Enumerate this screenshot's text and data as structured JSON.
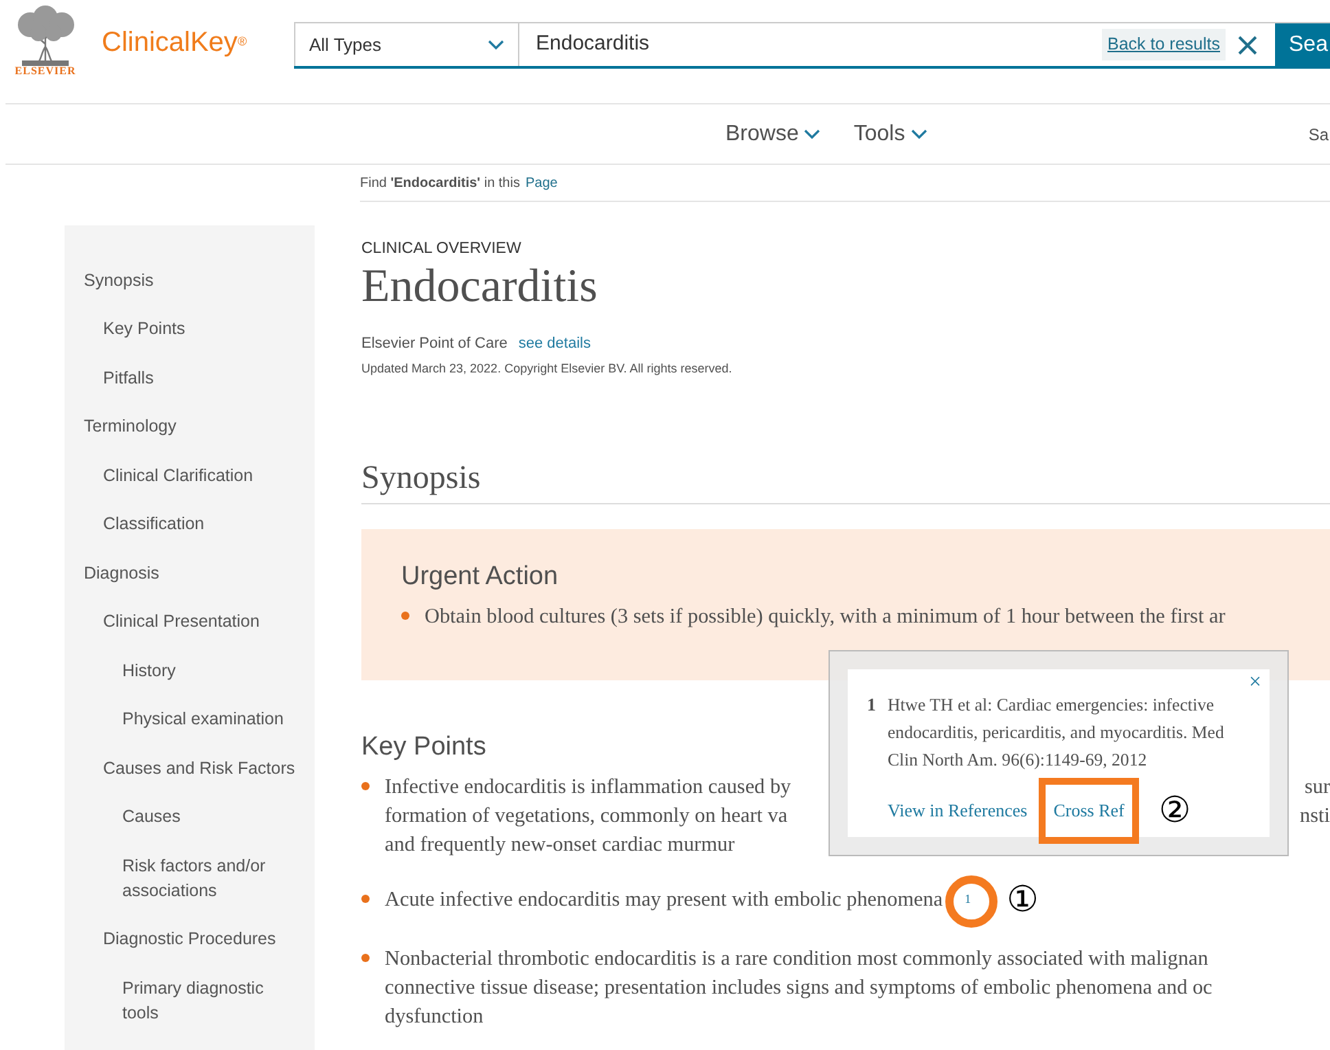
{
  "header": {
    "publisher": "ELSEVIER",
    "brand": "ClinicalKey",
    "brand_mark": "®",
    "search_type": "All Types",
    "search_value": "Endocarditis",
    "back_link": "Back to results",
    "search_button": "Sea"
  },
  "nav": {
    "items": [
      "Browse",
      "Tools"
    ],
    "right_item": "Sa"
  },
  "find_in_page": {
    "text": "Find **'Endocarditis'** in this",
    "link": "Page"
  },
  "sidebar": {
    "items": [
      {
        "label": "Synopsis",
        "children": [
          {
            "label": "Key Points"
          },
          {
            "label": "Pitfalls"
          }
        ]
      },
      {
        "label": "Terminology",
        "children": [
          {
            "label": "Clinical Clarification"
          },
          {
            "label": "Classification"
          }
        ]
      },
      {
        "label": "Diagnosis",
        "children": [
          {
            "label": "Clinical Presentation",
            "children": [
              {
                "label": "History"
              },
              {
                "label": "Physical examination"
              }
            ]
          },
          {
            "label": "Causes and Risk Factors",
            "children": [
              {
                "label": "Causes"
              },
              {
                "label": "Risk factors and/or associations"
              }
            ]
          },
          {
            "label": "Diagnostic Procedures",
            "children": [
              {
                "label": "Primary diagnostic tools"
              }
            ]
          }
        ]
      }
    ]
  },
  "article": {
    "label": "CLINICAL OVERVIEW",
    "title": "Endocarditis",
    "source": "Elsevier Point of Care",
    "source_link": "see details",
    "updated": "Updated March 23, 2022. Copyright Elsevier BV. All rights reserved."
  },
  "synopsis": {
    "heading": "Synopsis",
    "urgent": {
      "heading": "Urgent Action",
      "bullets": [
        "Obtain blood cultures (3 sets if possible) quickly, with a minimum of 1 hour between the first ar"
      ]
    }
  },
  "key_points": {
    "heading": "Key Points",
    "bullets": [
      {
        "lines": [
          {
            "left": "Infective endocarditis is inflammation caused by",
            "right": "sur"
          },
          {
            "left": "formation of vegetations, commonly on heart va",
            "right": "nsti"
          },
          {
            "left": "and frequently new-onset cardiac murmur"
          }
        ]
      },
      {
        "lines": [
          {
            "left": "Acute infective endocarditis may present with embolic phenomena",
            "ref": "1"
          }
        ]
      },
      {
        "lines": [
          {
            "left": "Nonbacterial thrombotic endocarditis is a rare condition most commonly associated with malignan"
          },
          {
            "left": "connective tissue disease; presentation includes signs and symptoms of embolic phenomena and oc"
          },
          {
            "left": "dysfunction"
          }
        ]
      }
    ]
  },
  "reference_popup": {
    "number": "1",
    "citation": "Htwe TH et al: Cardiac emergencies: infective endocarditis, pericarditis, and myocarditis. Med Clin North Am. 96(6):1149-69, 2012",
    "close": "×",
    "links": [
      "View in References",
      "Cross Ref"
    ]
  },
  "annotations": [
    {
      "kind": "circle",
      "label": "①"
    },
    {
      "kind": "rectangle",
      "label": "②"
    }
  ]
}
